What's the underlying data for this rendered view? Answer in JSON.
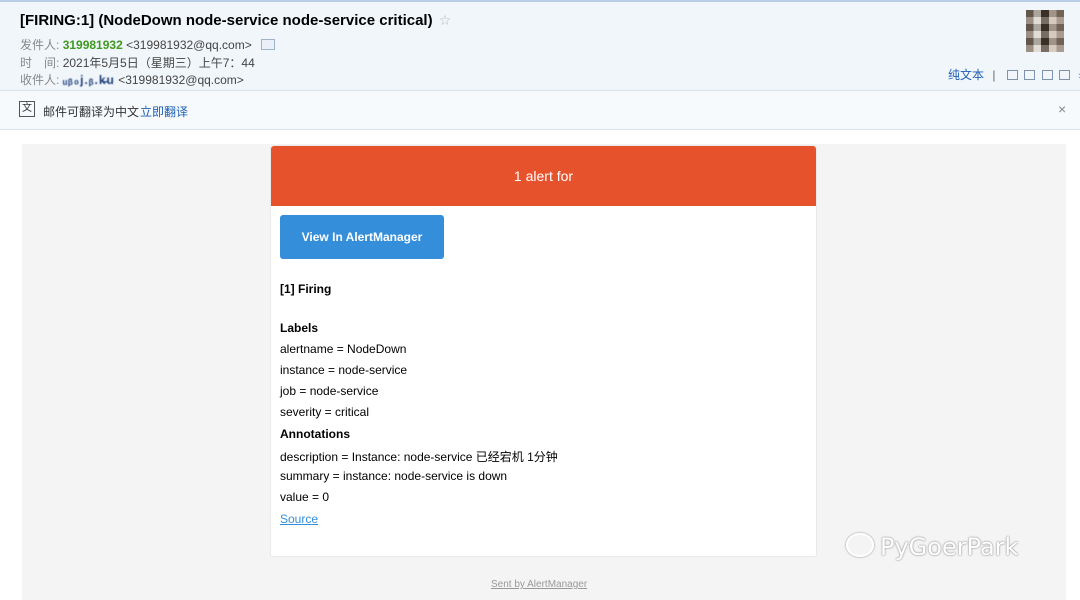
{
  "email": {
    "subject": "[FIRING:1] (NodeDown node-service node-service critical)",
    "star_icon": "☆",
    "from_label": "发件人:",
    "from_name": "319981932",
    "from_address": "<319981932@qq.com>",
    "time_label": "时　间:",
    "time_value": "2021年5月5日（星期三）上午7：44",
    "to_label": "收件人:",
    "to_name": "ᵤᵦ₀j.ᵦ.k̶u",
    "to_address": "<319981932@qq.com>",
    "plain_text": "纯文本",
    "separator": "|",
    "expand_icon": "»"
  },
  "translate_bar": {
    "icon_text": "文",
    "message": "邮件可翻译为中文",
    "action": "立即翻译",
    "close_icon": "×"
  },
  "alert": {
    "banner": "1 alert for",
    "button": "View In AlertManager",
    "firing_title": "[1] Firing",
    "labels_heading": "Labels",
    "labels": [
      "alertname = NodeDown",
      "instance = node-service",
      "job = node-service",
      "severity = critical"
    ],
    "annotations_heading": "Annotations",
    "annotations": [
      "description = Instance: node-service 已经宕机 1分钟",
      "summary = instance: node-service is down",
      "value = 0"
    ],
    "source_link": "Source",
    "footer": "Sent by AlertManager"
  },
  "watermark": {
    "text": "PyGoerPark"
  },
  "colors": {
    "banner": "#e6522c",
    "button": "#348eda",
    "link": "#348eda",
    "sender": "#3e9a1e"
  }
}
